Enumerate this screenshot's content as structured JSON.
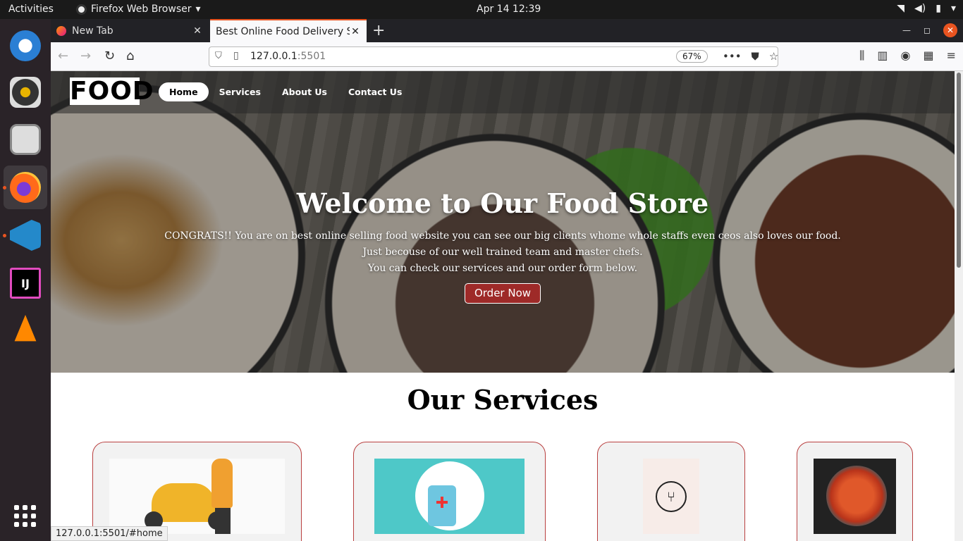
{
  "topbar": {
    "activities": "Activities",
    "app_menu": "Firefox Web Browser",
    "clock": "Apr 14  12:39"
  },
  "dock": {
    "items": [
      {
        "name": "thunderbird",
        "icon": "thunderbird-icon"
      },
      {
        "name": "rhythmbox",
        "icon": "rhythmbox-icon"
      },
      {
        "name": "files",
        "icon": "files-icon"
      },
      {
        "name": "firefox",
        "icon": "firefox-icon"
      },
      {
        "name": "vscode",
        "icon": "vscode-icon"
      },
      {
        "name": "intellij",
        "icon": "intellij-icon",
        "label": "IJ"
      },
      {
        "name": "vlc",
        "icon": "vlc-icon"
      }
    ]
  },
  "browser": {
    "tabs": [
      {
        "title": "New Tab"
      },
      {
        "title": "Best Online Food Delivery S"
      }
    ],
    "url_host": "127.0.0.1",
    "url_port": ":5501",
    "zoom": "67%",
    "status_url": "127.0.0.1:5501/#home"
  },
  "site": {
    "logo": "FOOD",
    "nav": [
      "Home",
      "Services",
      "About Us",
      "Contact Us"
    ],
    "hero_title": "Welcome to Our Food Store",
    "hero_text_1": "CONGRATS!! You are on best online selling food website you can see our big clients whome whole staffs even ceos also loves our food. Just becouse of our well trained team and master chefs.",
    "hero_text_2": "You can check our services and our order form below.",
    "order_button": "Order Now",
    "services_title": "Our Services"
  },
  "colors": {
    "accent": "#9e2a28",
    "card_border": "#b94040",
    "ubuntu_orange": "#e95420"
  }
}
